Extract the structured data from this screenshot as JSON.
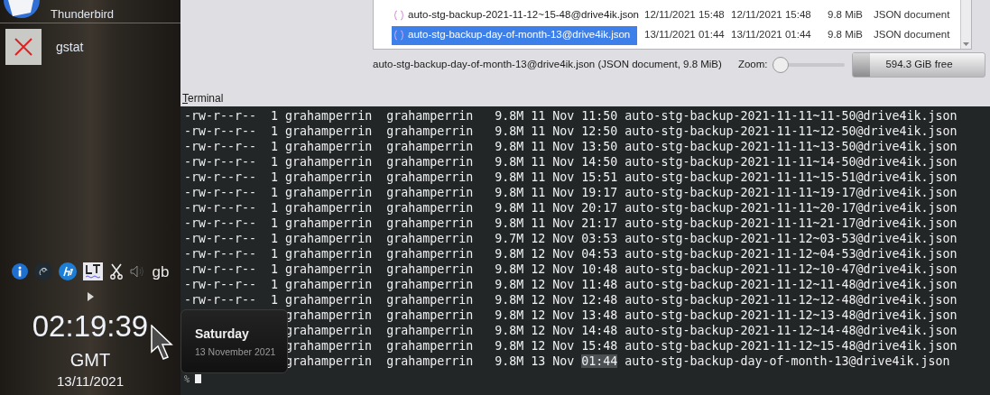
{
  "panel": {
    "apps": [
      {
        "name": "Thunderbird",
        "kind": "mail",
        "partial": true
      },
      {
        "name": "gstat",
        "kind": "broken",
        "partial": false
      }
    ],
    "tray": [
      {
        "kind": "info"
      },
      {
        "kind": "swirl"
      },
      {
        "kind": "hp"
      },
      {
        "kind": "lt"
      },
      {
        "kind": "scissors"
      },
      {
        "kind": "speaker"
      },
      {
        "kind": "text",
        "label": "gb"
      }
    ],
    "clock": {
      "time": "02:19:39",
      "zone": "GMT",
      "date": "13/11/2021"
    },
    "tooltip": {
      "title": "Saturday",
      "subtitle": "13 November 2021"
    }
  },
  "file_list": {
    "rows": [
      {
        "name": "auto-stg-backup-2021-11-12~15-48@drive4ik.json",
        "modified": "12/11/2021 15:48",
        "created": "12/11/2021 15:48",
        "size": "9.8 MiB",
        "type": "JSON document",
        "selected": false
      },
      {
        "name": "auto-stg-backup-day-of-month-13@drive4ik.json",
        "modified": "13/11/2021 01:44",
        "created": "13/11/2021 01:44",
        "size": "9.8 MiB",
        "type": "JSON document",
        "selected": true
      }
    ],
    "status": "auto-stg-backup-day-of-month-13@drive4ik.json (JSON document, 9.8 MiB)",
    "zoom_label": "Zoom:",
    "zoom": {
      "level": 0
    },
    "free_space": {
      "label": "594.3 GiB free",
      "level": 0.13
    }
  },
  "terminal": {
    "title": "Terminal",
    "lines": [
      {
        "kind": "full",
        "info": "-rw-r--r--  1 grahamperrin  grahamperrin   9.8M 11 Nov",
        "time": "11:50",
        "time_selected": false,
        "name": "auto-stg-backup-2021-11-11~11-50@drive4ik.json"
      },
      {
        "kind": "full",
        "info": "-rw-r--r--  1 grahamperrin  grahamperrin   9.8M 11 Nov",
        "time": "12:50",
        "time_selected": false,
        "name": "auto-stg-backup-2021-11-11~12-50@drive4ik.json"
      },
      {
        "kind": "full",
        "info": "-rw-r--r--  1 grahamperrin  grahamperrin   9.8M 11 Nov",
        "time": "13:50",
        "time_selected": false,
        "name": "auto-stg-backup-2021-11-11~13-50@drive4ik.json"
      },
      {
        "kind": "full",
        "info": "-rw-r--r--  1 grahamperrin  grahamperrin   9.8M 11 Nov",
        "time": "14:50",
        "time_selected": false,
        "name": "auto-stg-backup-2021-11-11~14-50@drive4ik.json"
      },
      {
        "kind": "full",
        "info": "-rw-r--r--  1 grahamperrin  grahamperrin   9.8M 11 Nov",
        "time": "15:51",
        "time_selected": false,
        "name": "auto-stg-backup-2021-11-11~15-51@drive4ik.json"
      },
      {
        "kind": "full",
        "info": "-rw-r--r--  1 grahamperrin  grahamperrin   9.8M 11 Nov",
        "time": "19:17",
        "time_selected": false,
        "name": "auto-stg-backup-2021-11-11~19-17@drive4ik.json"
      },
      {
        "kind": "full",
        "info": "-rw-r--r--  1 grahamperrin  grahamperrin   9.8M 11 Nov",
        "time": "20:17",
        "time_selected": false,
        "name": "auto-stg-backup-2021-11-11~20-17@drive4ik.json"
      },
      {
        "kind": "full",
        "info": "-rw-r--r--  1 grahamperrin  grahamperrin   9.8M 11 Nov",
        "time": "21:17",
        "time_selected": false,
        "name": "auto-stg-backup-2021-11-11~21-17@drive4ik.json"
      },
      {
        "kind": "full",
        "info": "-rw-r--r--  1 grahamperrin  grahamperrin   9.7M 12 Nov",
        "time": "03:53",
        "time_selected": false,
        "name": "auto-stg-backup-2021-11-12~03-53@drive4ik.json"
      },
      {
        "kind": "full",
        "info": "-rw-r--r--  1 grahamperrin  grahamperrin   9.8M 12 Nov",
        "time": "04:53",
        "time_selected": false,
        "name": "auto-stg-backup-2021-11-12~04-53@drive4ik.json"
      },
      {
        "kind": "full",
        "info": "-rw-r--r--  1 grahamperrin  grahamperrin   9.8M 12 Nov",
        "time": "10:48",
        "time_selected": false,
        "name": "auto-stg-backup-2021-11-12~10-47@drive4ik.json"
      },
      {
        "kind": "full",
        "info": "-rw-r--r--  1 grahamperrin  grahamperrin   9.8M 12 Nov",
        "time": "11:48",
        "time_selected": false,
        "name": "auto-stg-backup-2021-11-12~11-48@drive4ik.json"
      },
      {
        "kind": "full",
        "info": "-rw-r--r--  1 grahamperrin  grahamperrin   9.8M 12 Nov",
        "time": "12:48",
        "time_selected": false,
        "name": "auto-stg-backup-2021-11-12~12-48@drive4ik.json"
      },
      {
        "kind": "partial",
        "info": "grahamperrin  grahamperrin   9.8M 12 Nov",
        "time": "13:48",
        "time_selected": false,
        "name": "auto-stg-backup-2021-11-12~13-48@drive4ik.json"
      },
      {
        "kind": "partial",
        "info": "grahamperrin  grahamperrin   9.8M 12 Nov",
        "time": "14:48",
        "time_selected": false,
        "name": "auto-stg-backup-2021-11-12~14-48@drive4ik.json"
      },
      {
        "kind": "partial",
        "info": "grahamperrin  grahamperrin   9.8M 12 Nov",
        "time": "15:48",
        "time_selected": false,
        "name": "auto-stg-backup-2021-11-12~15-48@drive4ik.json"
      },
      {
        "kind": "partial",
        "info": "grahamperrin  grahamperrin   9.8M 13 Nov",
        "time": "01:44",
        "time_selected": true,
        "name": "auto-stg-backup-day-of-month-13@drive4ik.json"
      }
    ],
    "prompt": "%"
  }
}
